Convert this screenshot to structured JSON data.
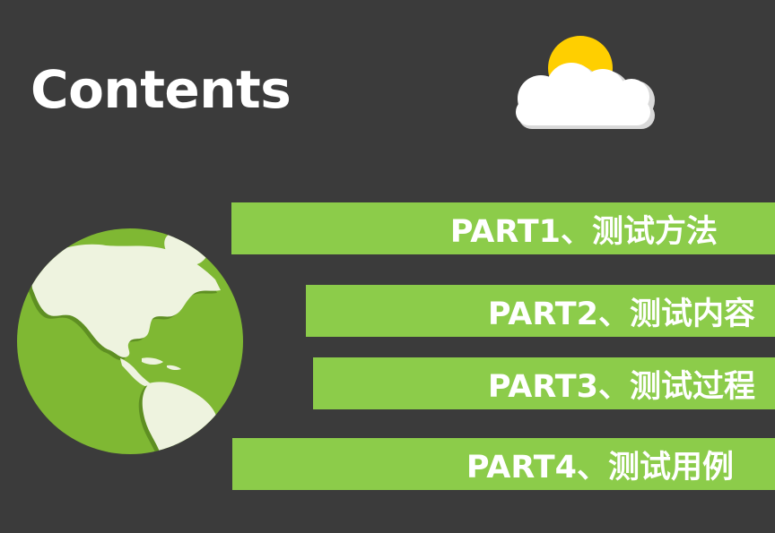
{
  "title": "Contents",
  "items": [
    {
      "label": "PART1、测试方法"
    },
    {
      "label": "PART2、测试内容"
    },
    {
      "label": "PART3、测试过程"
    },
    {
      "label": "PART4、测试用例"
    }
  ],
  "colors": {
    "background": "#3b3b3b",
    "bar": "#8ccc4a",
    "globe_ocean": "#7fb833",
    "globe_land": "#eef3df",
    "sun": "#ffcf00",
    "cloud": "#ffffff"
  },
  "icons": {
    "weather": "sun-behind-cloud-icon",
    "globe": "globe-americas-icon"
  }
}
